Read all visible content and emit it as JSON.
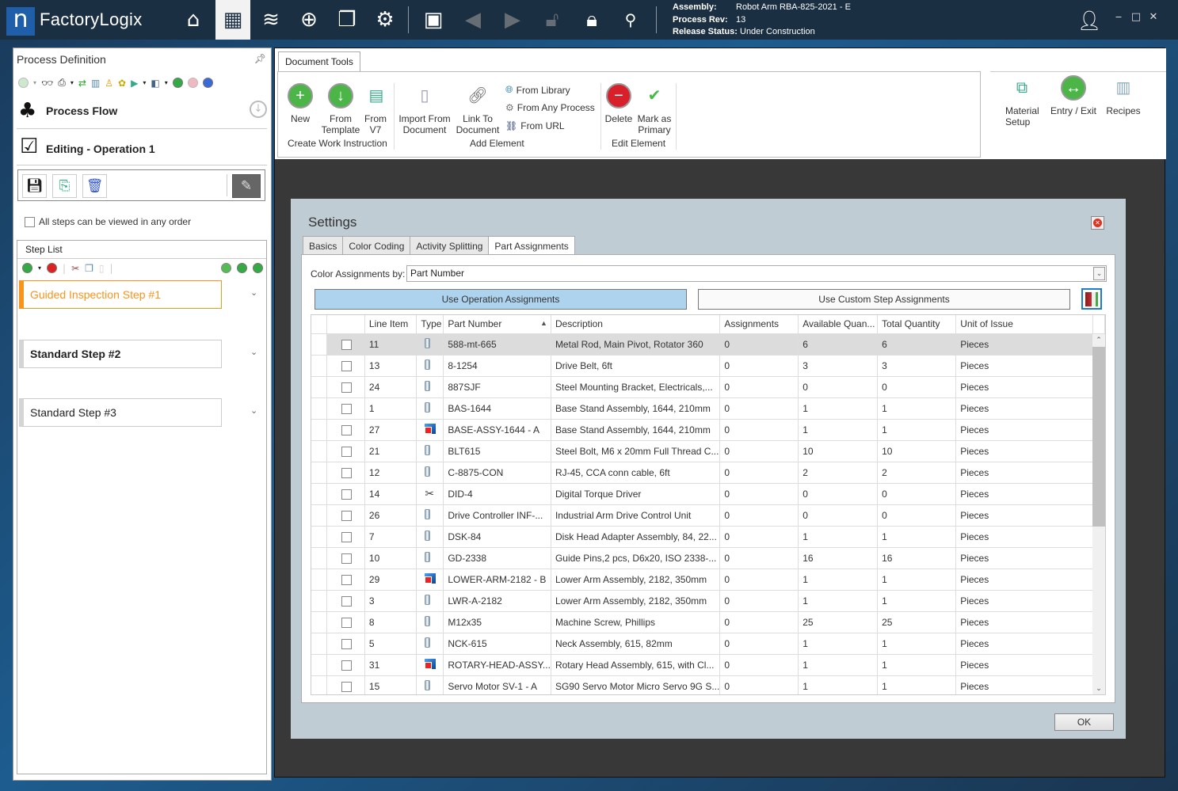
{
  "app": {
    "brand_prefix": "Factory",
    "brand_suffix": "Logix",
    "logo_glyph": "n"
  },
  "titlebar": {
    "icons": [
      "home-icon",
      "process-editor-icon",
      "database-icon",
      "navigate-icon",
      "windows-icon",
      "settings-icon",
      "save-icon",
      "back-icon",
      "forward-icon",
      "unlock-icon",
      "lock-icon",
      "hierarchy-search-icon"
    ],
    "assembly_label": "Assembly:",
    "assembly_value": "Robot Arm RBA-825-2021 - E",
    "rev_label": "Process Rev:",
    "rev_value": "13",
    "status_label": "Release Status:",
    "status_value": "Under Construction",
    "window_controls": {
      "minimize": "‒",
      "maximize": "□",
      "close": "✕"
    }
  },
  "left_panel": {
    "title": "Process Definition",
    "process_flow_label": "Process Flow",
    "editing_label": "Editing - Operation 1",
    "any_order_label": "All steps can be viewed in any order",
    "any_order_checked": false,
    "step_list_title": "Step List",
    "steps": [
      {
        "label": "Guided Inspection Step #1",
        "selected": true,
        "bold": false
      },
      {
        "label": "Standard Step #2",
        "selected": false,
        "bold": true
      },
      {
        "label": "Standard Step #3",
        "selected": false,
        "bold": false
      }
    ]
  },
  "ribbon": {
    "tab": "Document Tools",
    "groups": {
      "create": "Create Work Instruction",
      "add": "Add Element",
      "edit": "Edit Element"
    },
    "buttons": {
      "new": "New",
      "from_template_1": "From",
      "from_template_2": "Template",
      "from_v7_1": "From",
      "from_v7_2": "V7",
      "import_1": "Import From",
      "import_2": "Document",
      "link_1": "Link To",
      "link_2": "Document",
      "from_library": "From Library",
      "from_any_process": "From Any Process",
      "from_url": "From URL",
      "delete": "Delete",
      "mark_1": "Mark as",
      "mark_2": "Primary",
      "material_1": "Material",
      "material_2": "Setup",
      "entry_exit": "Entry / Exit",
      "recipes": "Recipes"
    }
  },
  "settings": {
    "title": "Settings",
    "tabs": [
      "Basics",
      "Color Coding",
      "Activity Splitting",
      "Part Assignments"
    ],
    "active_tab": "Part Assignments",
    "color_assign_label": "Color Assignments by:",
    "color_assign_value": "Part Number",
    "use_operation_label": "Use Operation Assignments",
    "use_custom_label": "Use Custom Step Assignments",
    "ok_label": "OK",
    "columns": [
      "Line Item",
      "Type",
      "Part Number",
      "Description",
      "Assignments",
      "Available Quan...",
      "Total Quantity",
      "Unit of Issue"
    ],
    "sorted_column": "Part Number",
    "sort_direction": "ascending",
    "rows": [
      {
        "line": "11",
        "type": "part",
        "part": "588-mt-665",
        "desc": "Metal Rod, Main Pivot, Rotator 360",
        "assign": "0",
        "avail": "6",
        "total": "6",
        "unit": "Pieces",
        "highlighted": true
      },
      {
        "line": "13",
        "type": "part",
        "part": "8-1254",
        "desc": "Drive Belt, 6ft",
        "assign": "0",
        "avail": "3",
        "total": "3",
        "unit": "Pieces"
      },
      {
        "line": "24",
        "type": "part",
        "part": "887SJF",
        "desc": "Steel Mounting Bracket, Electricals,...",
        "assign": "0",
        "avail": "0",
        "total": "0",
        "unit": "Pieces"
      },
      {
        "line": "1",
        "type": "part",
        "part": "BAS-1644",
        "desc": "Base Stand Assembly, 1644, 210mm",
        "assign": "0",
        "avail": "1",
        "total": "1",
        "unit": "Pieces"
      },
      {
        "line": "27",
        "type": "assembly",
        "part": "BASE-ASSY-1644 - A",
        "desc": "Base Stand Assembly, 1644, 210mm",
        "assign": "0",
        "avail": "1",
        "total": "1",
        "unit": "Pieces"
      },
      {
        "line": "21",
        "type": "part",
        "part": "BLT615",
        "desc": "Steel Bolt, M6 x 20mm Full Thread C...",
        "assign": "0",
        "avail": "10",
        "total": "10",
        "unit": "Pieces"
      },
      {
        "line": "12",
        "type": "part",
        "part": "C-8875-CON",
        "desc": "RJ-45, CCA conn cable, 6ft",
        "assign": "0",
        "avail": "2",
        "total": "2",
        "unit": "Pieces"
      },
      {
        "line": "14",
        "type": "tool",
        "part": "DID-4",
        "desc": "Digital Torque Driver",
        "assign": "0",
        "avail": "0",
        "total": "0",
        "unit": "Pieces"
      },
      {
        "line": "26",
        "type": "part",
        "part": "Drive Controller INF-...",
        "desc": "Industrial Arm Drive Control Unit",
        "assign": "0",
        "avail": "0",
        "total": "0",
        "unit": "Pieces"
      },
      {
        "line": "7",
        "type": "part",
        "part": "DSK-84",
        "desc": "Disk Head Adapter Assembly, 84, 22...",
        "assign": "0",
        "avail": "1",
        "total": "1",
        "unit": "Pieces"
      },
      {
        "line": "10",
        "type": "part",
        "part": "GD-2338",
        "desc": "Guide Pins,2 pcs, D6x20, ISO 2338-...",
        "assign": "0",
        "avail": "16",
        "total": "16",
        "unit": "Pieces"
      },
      {
        "line": "29",
        "type": "assembly",
        "part": "LOWER-ARM-2182 - B",
        "desc": "Lower Arm Assembly, 2182, 350mm",
        "assign": "0",
        "avail": "1",
        "total": "1",
        "unit": "Pieces"
      },
      {
        "line": "3",
        "type": "part",
        "part": "LWR-A-2182",
        "desc": "Lower Arm Assembly, 2182, 350mm",
        "assign": "0",
        "avail": "1",
        "total": "1",
        "unit": "Pieces"
      },
      {
        "line": "8",
        "type": "part",
        "part": "M12x35",
        "desc": "Machine Screw, Phillips",
        "assign": "0",
        "avail": "25",
        "total": "25",
        "unit": "Pieces"
      },
      {
        "line": "5",
        "type": "part",
        "part": "NCK-615",
        "desc": "Neck Assembly, 615, 82mm",
        "assign": "0",
        "avail": "1",
        "total": "1",
        "unit": "Pieces"
      },
      {
        "line": "31",
        "type": "assembly",
        "part": "ROTARY-HEAD-ASSY...",
        "desc": "Rotary Head Assembly, 615, with Cl...",
        "assign": "0",
        "avail": "1",
        "total": "1",
        "unit": "Pieces"
      },
      {
        "line": "15",
        "type": "part",
        "part": "Servo Motor SV-1 - A",
        "desc": "SG90 Servo Motor Micro Servo 9G S...",
        "assign": "0",
        "avail": "1",
        "total": "1",
        "unit": "Pieces"
      }
    ]
  },
  "colors": {
    "accent_orange": "#f7941d",
    "titlebar_bg": "#1b2f42",
    "selected_button": "#aed3ee",
    "dialog_bg": "#c0ccd4"
  }
}
